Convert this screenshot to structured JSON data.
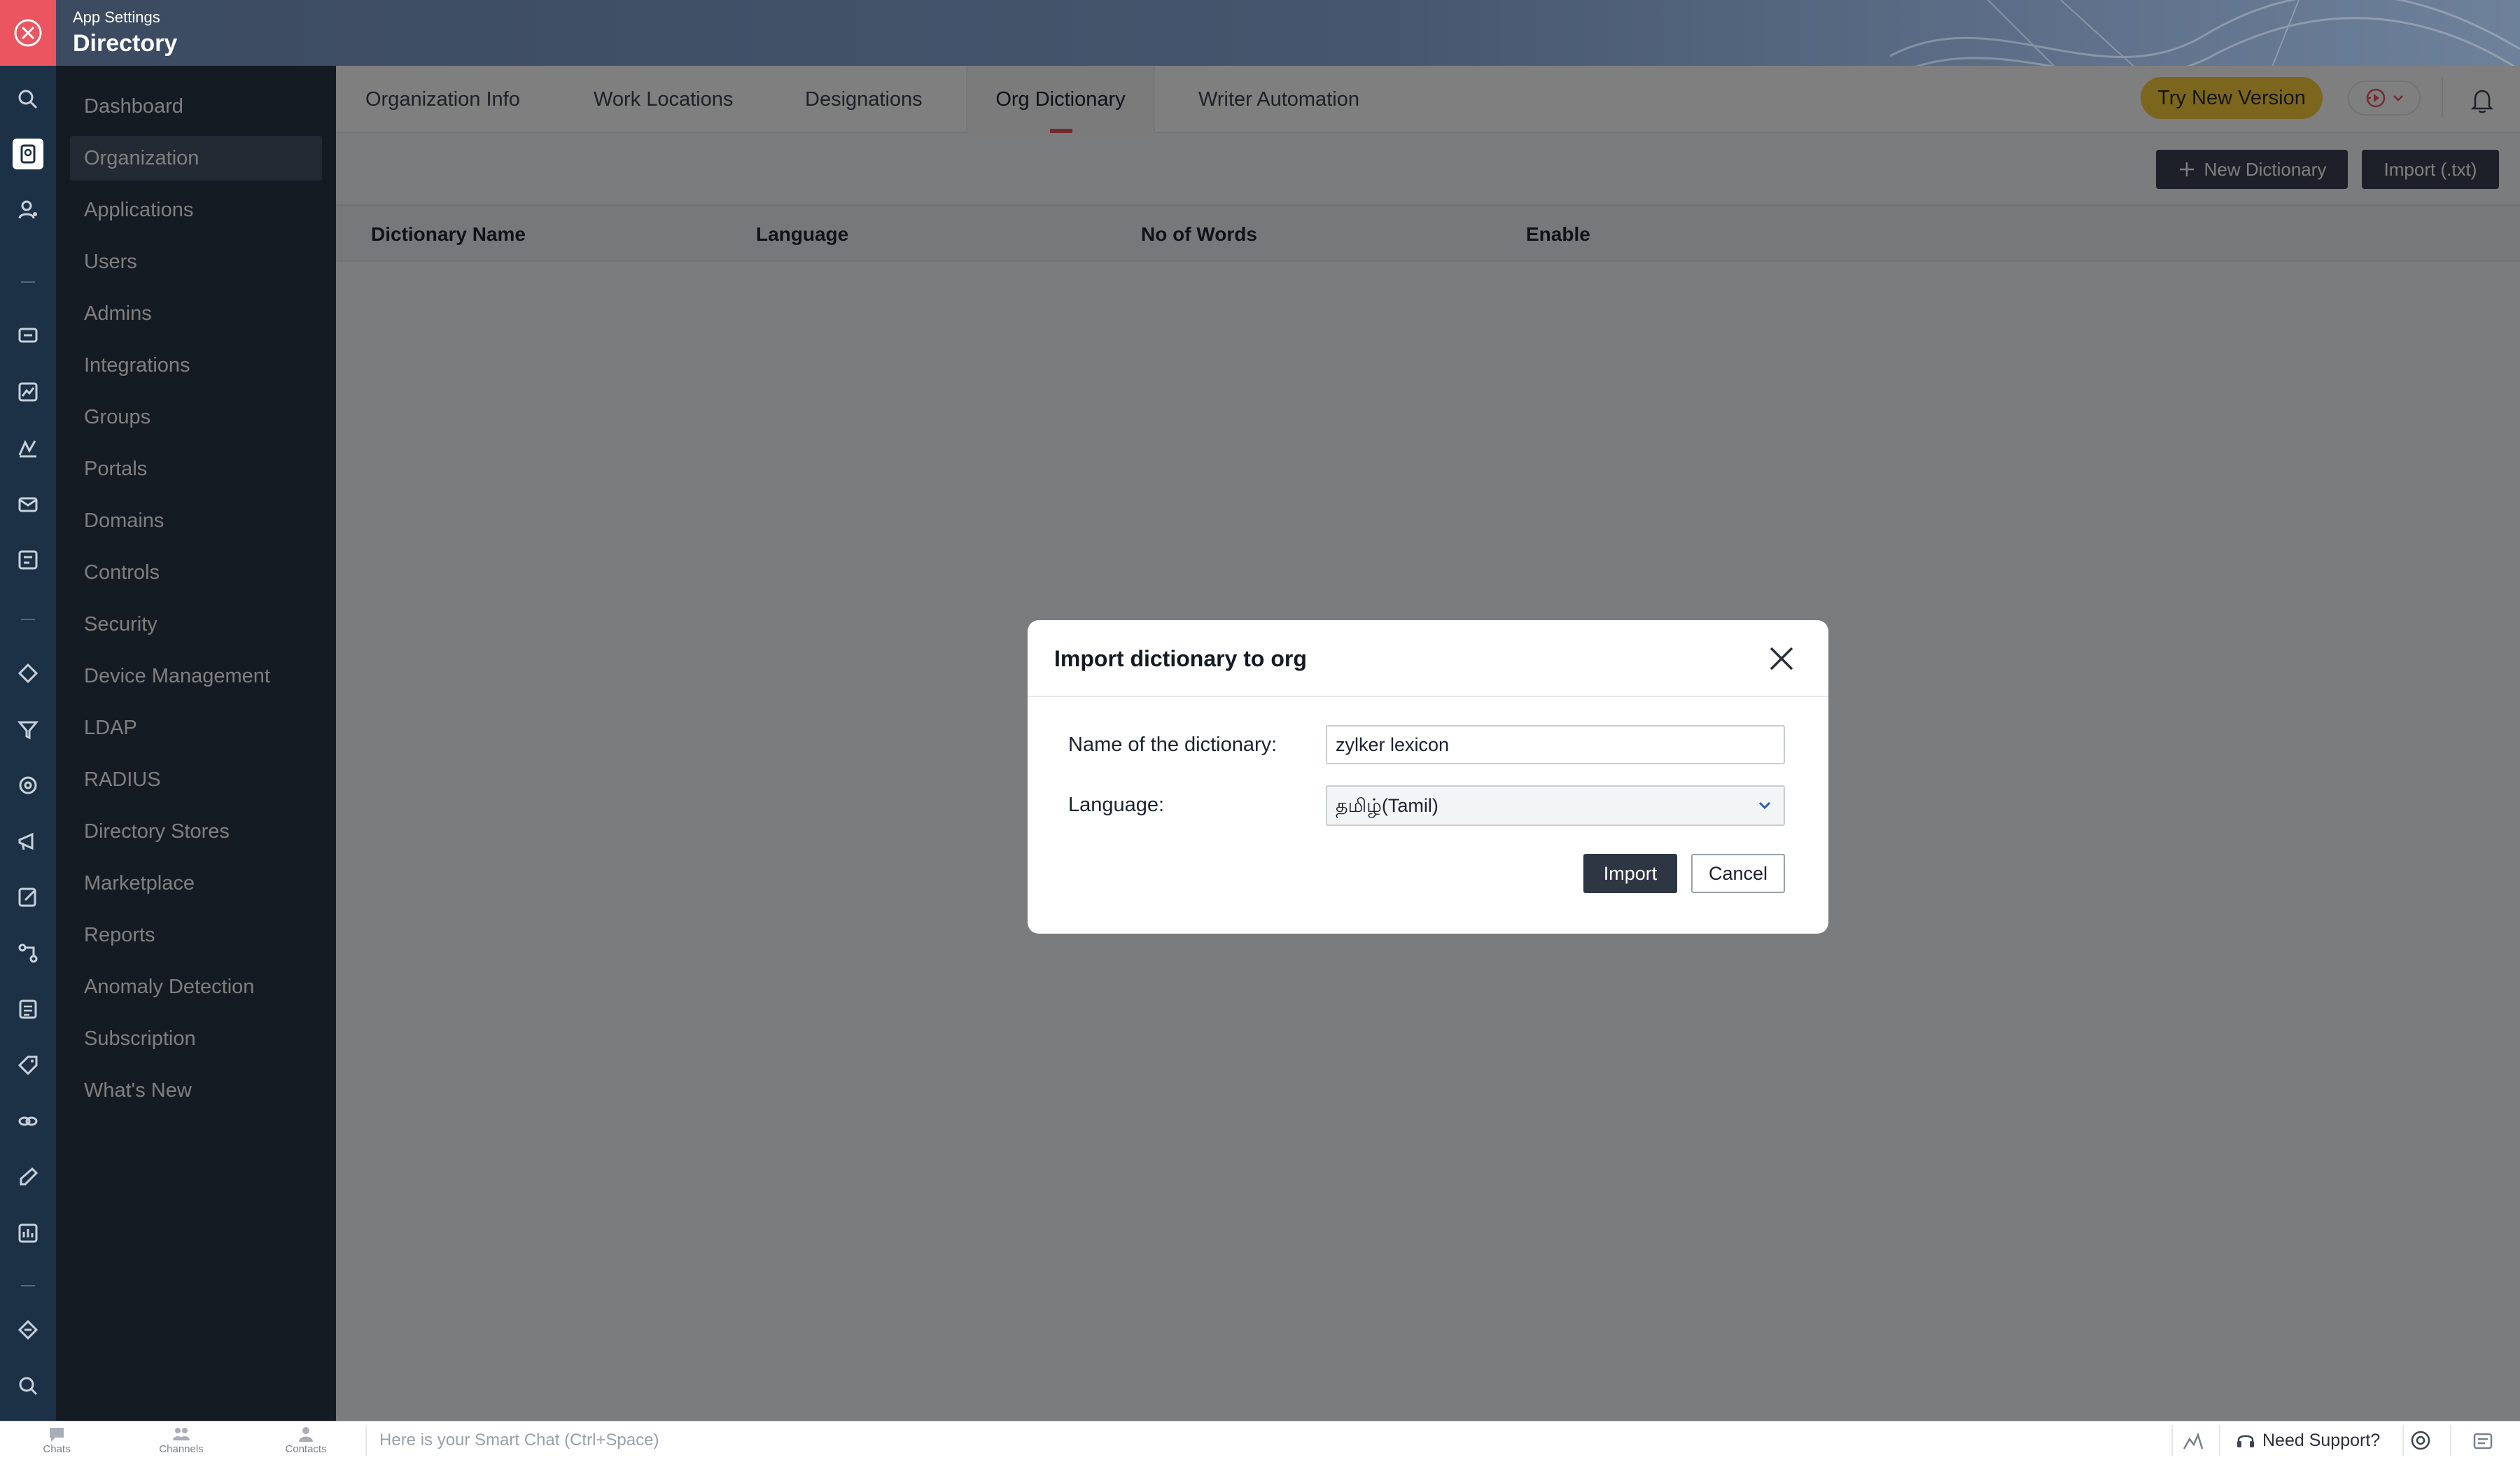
{
  "header": {
    "caption": "App Settings",
    "title": "Directory",
    "close_icon": "close-icon"
  },
  "rail": {
    "icons": [
      "search-icon",
      "directory-icon",
      "user-icon",
      "chat-icon",
      "analytics-icon",
      "chart-icon",
      "mail-icon",
      "workflow-icon",
      "settings-icon",
      "filter-icon",
      "support-icon",
      "campaign-icon",
      "edit-icon",
      "flow-icon",
      "docs-icon",
      "tag-icon",
      "link-icon",
      "sign-icon",
      "report-icon",
      "ticket-icon",
      "explore-icon"
    ]
  },
  "sidebar": {
    "items": [
      {
        "label": "Dashboard"
      },
      {
        "label": "Organization",
        "active": true
      },
      {
        "label": "Applications"
      },
      {
        "label": "Users"
      },
      {
        "label": "Admins"
      },
      {
        "label": "Integrations"
      },
      {
        "label": "Groups"
      },
      {
        "label": "Portals"
      },
      {
        "label": "Domains"
      },
      {
        "label": "Controls"
      },
      {
        "label": "Security"
      },
      {
        "label": "Device Management"
      },
      {
        "label": "LDAP"
      },
      {
        "label": "RADIUS"
      },
      {
        "label": "Directory Stores"
      },
      {
        "label": "Marketplace"
      },
      {
        "label": "Reports"
      },
      {
        "label": "Anomaly Detection"
      },
      {
        "label": "Subscription"
      },
      {
        "label": "What's New"
      }
    ]
  },
  "tabs": [
    {
      "label": "Organization Info"
    },
    {
      "label": "Work Locations"
    },
    {
      "label": "Designations"
    },
    {
      "label": "Org Dictionary",
      "active": true
    },
    {
      "label": "Writer Automation"
    }
  ],
  "toolbar": {
    "try_new_version": "Try New Version",
    "new_dictionary": "New Dictionary",
    "import_txt": "Import (.txt)"
  },
  "table": {
    "columns": [
      "Dictionary Name",
      "Language",
      "No of Words",
      "Enable"
    ]
  },
  "modal": {
    "title": "Import dictionary to org",
    "name_label": "Name of the dictionary:",
    "name_value": "zylker lexicon",
    "language_label": "Language:",
    "language_value": "தமிழ்(Tamil)",
    "import_button": "Import",
    "cancel_button": "Cancel"
  },
  "bottombar": {
    "chats": "Chats",
    "channels": "Channels",
    "contacts": "Contacts",
    "smartchat_placeholder": "Here is your Smart Chat (Ctrl+Space)",
    "need_support": "Need Support?"
  },
  "colors": {
    "accent": "#ea5560",
    "sidebar_bg": "#2a3646",
    "rail_bg": "#1c3146",
    "try_button": "#f9cd3c"
  }
}
